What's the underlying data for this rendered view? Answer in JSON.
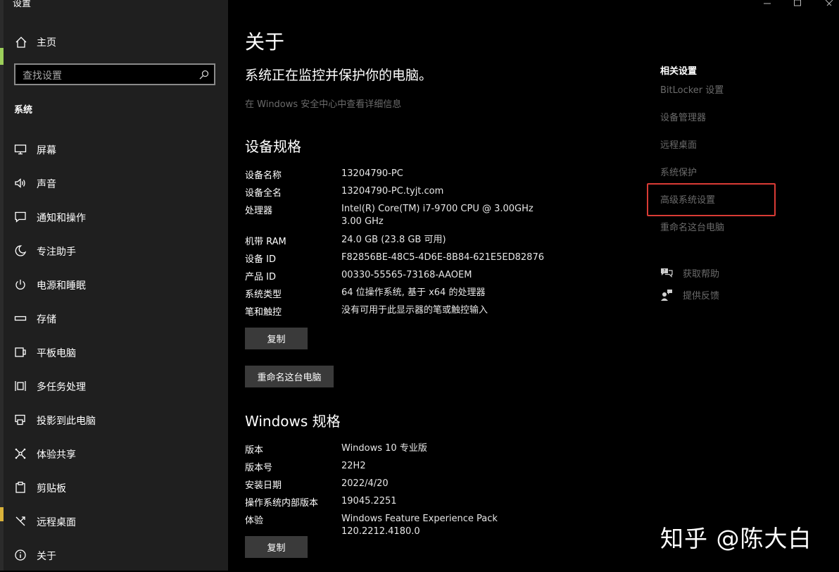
{
  "window": {
    "title": "设置"
  },
  "sidebar": {
    "home_label": "主页",
    "search_placeholder": "查找设置",
    "section": "系统",
    "items": [
      {
        "label": "屏幕",
        "icon": "monitor-icon"
      },
      {
        "label": "声音",
        "icon": "speaker-icon"
      },
      {
        "label": "通知和操作",
        "icon": "notification-icon"
      },
      {
        "label": "专注助手",
        "icon": "moon-icon"
      },
      {
        "label": "电源和睡眠",
        "icon": "power-icon"
      },
      {
        "label": "存储",
        "icon": "storage-icon"
      },
      {
        "label": "平板电脑",
        "icon": "tablet-icon"
      },
      {
        "label": "多任务处理",
        "icon": "multitask-icon"
      },
      {
        "label": "投影到此电脑",
        "icon": "project-icon"
      },
      {
        "label": "体验共享",
        "icon": "share-icon"
      },
      {
        "label": "剪贴板",
        "icon": "clipboard-icon"
      },
      {
        "label": "远程桌面",
        "icon": "remote-desktop-icon"
      },
      {
        "label": "关于",
        "icon": "info-icon"
      }
    ]
  },
  "main": {
    "title": "关于",
    "protect_text": "系统正在监控并保护你的电脑。",
    "security_link": "在 Windows 安全中心中查看详细信息",
    "device_spec_title": "设备规格",
    "device_specs": [
      {
        "k": "设备名称",
        "v": "13204790-PC"
      },
      {
        "k": "设备全名",
        "v": "13204790-PC.tyjt.com"
      },
      {
        "k": "处理器",
        "v": "Intel(R) Core(TM) i7-9700 CPU @ 3.00GHz   3.00 GHz"
      },
      {
        "k": "机带 RAM",
        "v": "24.0 GB (23.8 GB 可用)"
      },
      {
        "k": "设备 ID",
        "v": "F82856BE-48C5-4D6E-8B84-621E5ED82876"
      },
      {
        "k": "产品 ID",
        "v": "00330-55565-73168-AAOEM"
      },
      {
        "k": "系统类型",
        "v": "64 位操作系统, 基于 x64 的处理器"
      },
      {
        "k": "笔和触控",
        "v": "没有可用于此显示器的笔或触控输入"
      }
    ],
    "copy_label": "复制",
    "rename_label": "重命名这台电脑",
    "windows_spec_title": "Windows 规格",
    "windows_specs": [
      {
        "k": "版本",
        "v": "Windows 10 专业版"
      },
      {
        "k": "版本号",
        "v": "22H2"
      },
      {
        "k": "安装日期",
        "v": "2022/4/20"
      },
      {
        "k": "操作系统内部版本",
        "v": "19045.2251"
      },
      {
        "k": "体验",
        "v": "Windows Feature Experience Pack 120.2212.4180.0"
      }
    ],
    "copy2_label": "复制"
  },
  "related": {
    "title": "相关设置",
    "links": [
      "BitLocker 设置",
      "设备管理器",
      "远程桌面",
      "系统保护",
      "高级系统设置",
      "重命名这台电脑"
    ],
    "help": "获取帮助",
    "feedback": "提供反馈"
  },
  "watermark": "知乎 @陈大白"
}
